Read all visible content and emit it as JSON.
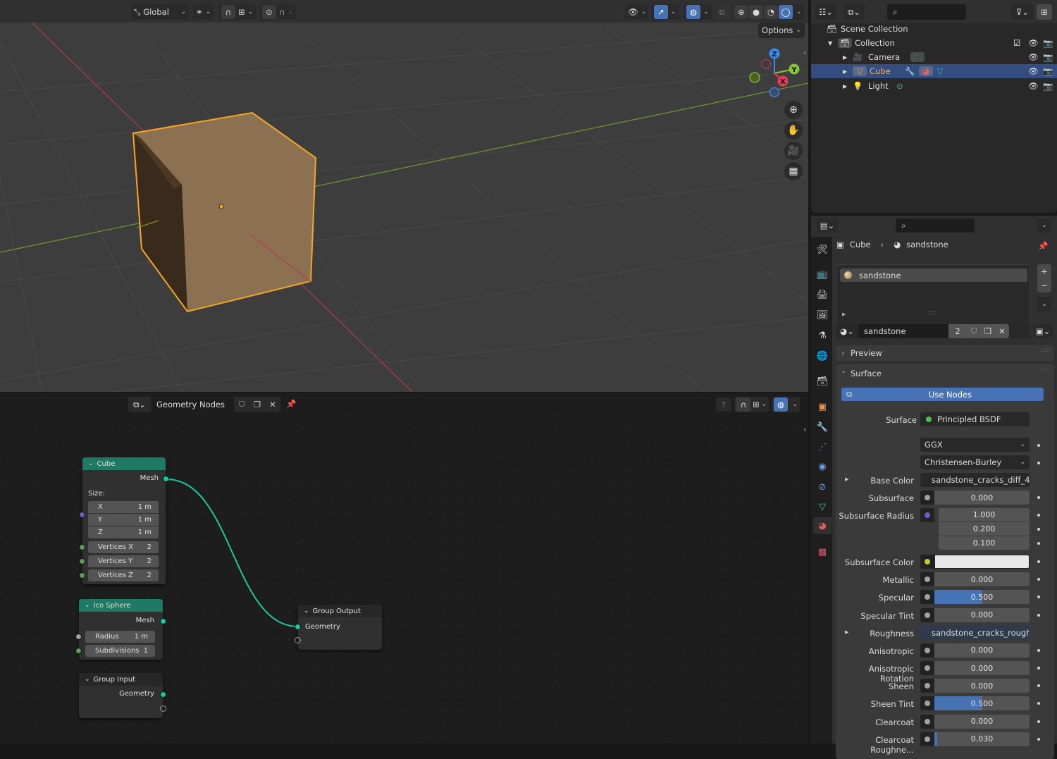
{
  "viewport": {
    "transform_orientation": "Global",
    "options_label": "Options",
    "gizmo_axes": [
      "X",
      "Y",
      "Z"
    ],
    "colors": {
      "selection_outline": "#f5a623",
      "x_axis": "#e83d58",
      "y_axis": "#86c33a",
      "z_axis": "#3c8de5",
      "cube_front": "#8a7050",
      "cube_side": "#3b2a1a"
    }
  },
  "node_editor": {
    "node_group_name": "Geometry Nodes",
    "nodes": {
      "cube": {
        "title": "Cube",
        "output": "Mesh",
        "size_label": "Size:",
        "size": [
          {
            "label": "X",
            "value": "1 m"
          },
          {
            "label": "Y",
            "value": "1 m"
          },
          {
            "label": "Z",
            "value": "1 m"
          }
        ],
        "vertices": [
          {
            "label": "Vertices X",
            "value": "2"
          },
          {
            "label": "Vertices Y",
            "value": "2"
          },
          {
            "label": "Vertices Z",
            "value": "2"
          }
        ]
      },
      "ico_sphere": {
        "title": "Ico Sphere",
        "output": "Mesh",
        "fields": [
          {
            "label": "Radius",
            "value": "1 m"
          },
          {
            "label": "Subdivisions",
            "value": "1"
          }
        ]
      },
      "group_input": {
        "title": "Group Input",
        "output": "Geometry"
      },
      "group_output": {
        "title": "Group Output",
        "input": "Geometry"
      }
    }
  },
  "outliner": {
    "search_placeholder": "",
    "items": [
      {
        "label": "Scene Collection"
      },
      {
        "label": "Collection"
      },
      {
        "label": "Camera"
      },
      {
        "label": "Cube",
        "selected": true
      },
      {
        "label": "Light"
      }
    ]
  },
  "properties": {
    "breadcrumb": {
      "object": "Cube",
      "material": "sandstone"
    },
    "material_slots": [
      "sandstone"
    ],
    "material_name": "sandstone",
    "user_count": "2",
    "sections": {
      "preview": "Preview",
      "surface": "Surface"
    },
    "use_nodes_label": "Use Nodes",
    "surface_label": "Surface",
    "surface_shader": "Principled BSDF",
    "distribution": "GGX",
    "subsurface_method": "Christensen-Burley",
    "rows": [
      {
        "label": "Base Color",
        "type": "link",
        "value": "sandstone_cracks_diff_4...",
        "socket": "#c7c729"
      },
      {
        "label": "Subsurface",
        "type": "slider",
        "value": "0.000",
        "fraction": 0,
        "socket": "#a1a1a1"
      },
      {
        "label": "Subsurface Radius",
        "type": "vector",
        "values": [
          "1.000",
          "0.200",
          "0.100"
        ],
        "socket": "#6363c7"
      },
      {
        "label": "Subsurface Color",
        "type": "color",
        "value": "#e8e8e8",
        "socket": "#c7c729"
      },
      {
        "label": "Metallic",
        "type": "slider",
        "value": "0.000",
        "fraction": 0,
        "socket": "#a1a1a1"
      },
      {
        "label": "Specular",
        "type": "slider",
        "value": "0.500",
        "fraction": 0.5,
        "socket": "#a1a1a1"
      },
      {
        "label": "Specular Tint",
        "type": "slider",
        "value": "0.000",
        "fraction": 0,
        "socket": "#a1a1a1"
      },
      {
        "label": "Roughness",
        "type": "link",
        "value": "sandstone_cracks_rough...",
        "socket": "#a1a1a1"
      },
      {
        "label": "Anisotropic",
        "type": "slider",
        "value": "0.000",
        "fraction": 0,
        "socket": "#a1a1a1"
      },
      {
        "label": "Anisotropic Rotation",
        "type": "slider",
        "value": "0.000",
        "fraction": 0,
        "socket": "#a1a1a1"
      },
      {
        "label": "Sheen",
        "type": "slider",
        "value": "0.000",
        "fraction": 0,
        "socket": "#a1a1a1"
      },
      {
        "label": "Sheen Tint",
        "type": "slider",
        "value": "0.500",
        "fraction": 0.5,
        "socket": "#a1a1a1"
      },
      {
        "label": "Clearcoat",
        "type": "slider",
        "value": "0.000",
        "fraction": 0,
        "socket": "#a1a1a1"
      },
      {
        "label": "Clearcoat Roughne...",
        "type": "slider",
        "value": "0.030",
        "fraction": 0.03,
        "socket": "#a1a1a1"
      }
    ],
    "accent_color": "#4772b3"
  }
}
